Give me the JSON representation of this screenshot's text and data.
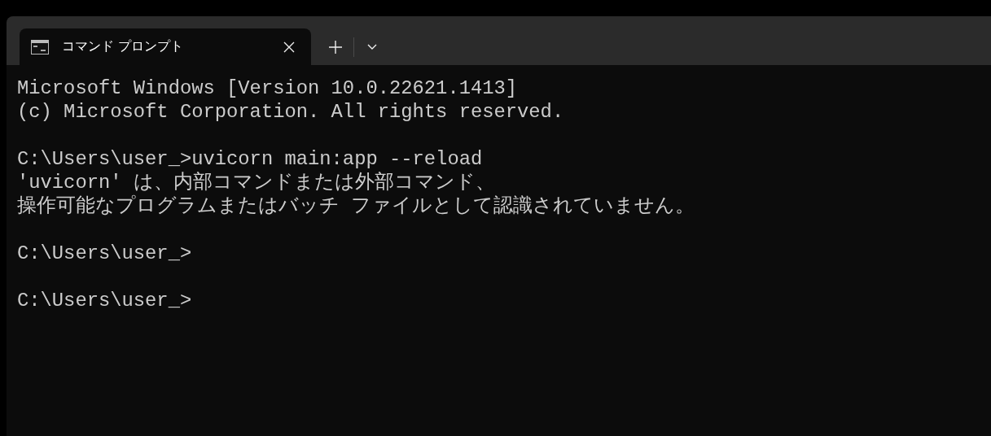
{
  "tabs": [
    {
      "title": "コマンド プロンプト",
      "selected": true
    }
  ],
  "terminal": {
    "blocks": [
      [
        "Microsoft Windows [Version 10.0.22621.1413]",
        "(c) Microsoft Corporation. All rights reserved."
      ],
      [
        "C:\\Users\\user_>uvicorn main:app --reload",
        "'uvicorn' は、内部コマンドまたは外部コマンド、",
        "操作可能なプログラムまたはバッチ ファイルとして認識されていません。"
      ],
      [
        "C:\\Users\\user_>"
      ],
      [
        "C:\\Users\\user_>"
      ]
    ]
  }
}
